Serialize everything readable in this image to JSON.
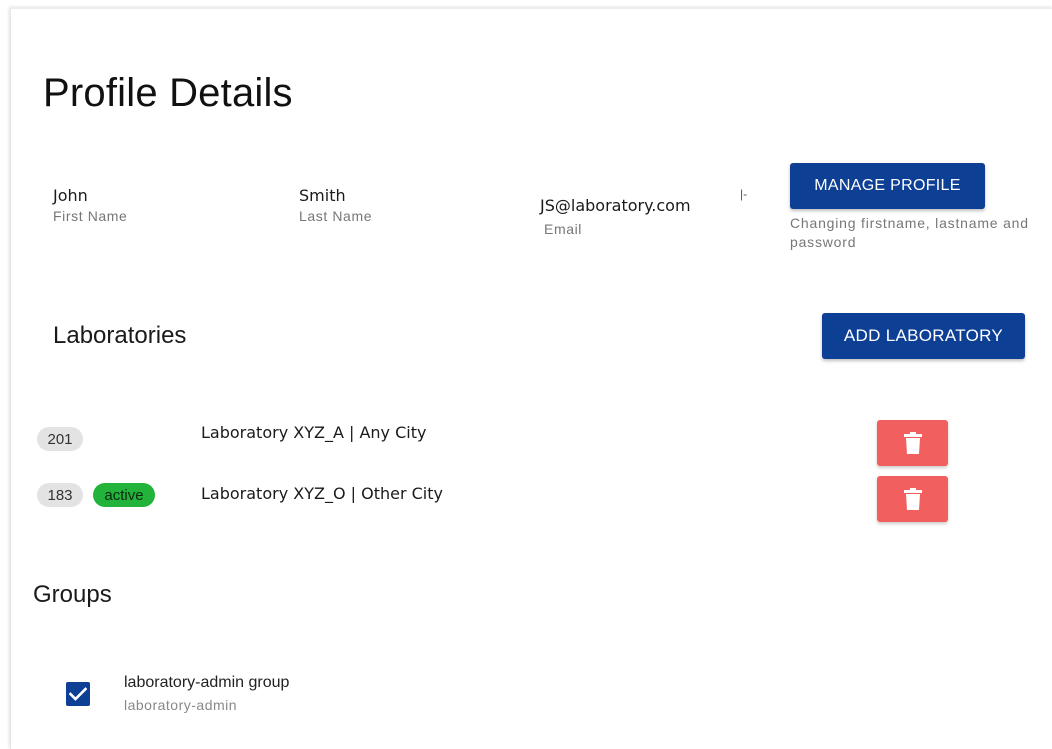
{
  "page": {
    "title": "Profile Details"
  },
  "profile": {
    "first_name": {
      "value": "John",
      "label": "First Name"
    },
    "last_name": {
      "value": "Smith",
      "label": "Last Name"
    },
    "email": {
      "value": "JS@laboratory.com",
      "label": "Email"
    },
    "manage_button": "MANAGE PROFILE",
    "manage_helper": "Changing firstname, lastname and password",
    "stray_mark": "|-"
  },
  "laboratories": {
    "title": "Laboratories",
    "add_button": "ADD LABORATORY",
    "items": [
      {
        "id": "201",
        "status": "",
        "name": "Laboratory XYZ_A | Any City",
        "delete_icon": "trash-icon"
      },
      {
        "id": "183",
        "status": "active",
        "name": "Laboratory XYZ_O | Other City",
        "delete_icon": "trash-icon"
      }
    ]
  },
  "groups": {
    "title": "Groups",
    "items": [
      {
        "name": "laboratory-admin group",
        "subtitle": "laboratory-admin",
        "checked": true
      }
    ]
  },
  "colors": {
    "primary": "#0d3f95",
    "delete": "#f25f5f",
    "active_chip": "#22b33a",
    "chip": "#e3e3e3"
  }
}
